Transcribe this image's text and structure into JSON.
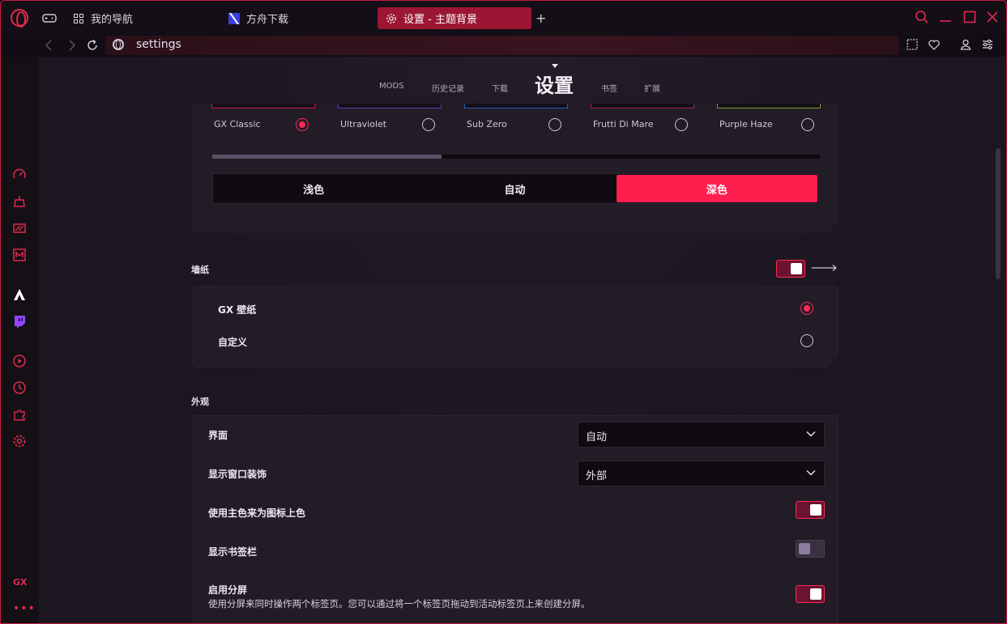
{
  "window": {
    "tabs": [
      {
        "label": "我的导航"
      },
      {
        "label": "方舟下载"
      },
      {
        "label": "设置 - 主题背景"
      }
    ],
    "new_tab": "+"
  },
  "address": {
    "url": "settings"
  },
  "settings_nav": {
    "items": [
      "MODS",
      "历史记录",
      "下载",
      "设置",
      "书签",
      "扩展"
    ]
  },
  "themes": {
    "items": [
      {
        "name": "GX Classic",
        "selected": true,
        "color": "#c41b42"
      },
      {
        "name": "Ultraviolet",
        "selected": false,
        "color": "#5a3aa8"
      },
      {
        "name": "Sub Zero",
        "selected": false,
        "color": "#2a5cb8"
      },
      {
        "name": "Frutti Di Mare",
        "selected": false,
        "color": "#a02050"
      },
      {
        "name": "Purple Haze",
        "selected": false,
        "color": "#7a9a30"
      }
    ],
    "slider_fraction": 0.377,
    "modes": [
      "浅色",
      "自动",
      "深色"
    ],
    "active_mode": "深色"
  },
  "wallpaper": {
    "label": "墙纸",
    "enabled": true,
    "options": [
      {
        "label": "GX 壁纸",
        "selected": true
      },
      {
        "label": "自定义",
        "selected": false
      }
    ]
  },
  "appearance": {
    "label": "外观",
    "rows": [
      {
        "label": "界面",
        "value": "自动"
      },
      {
        "label": "显示窗口装饰",
        "value": "外部"
      },
      {
        "label": "使用主色来为图标上色",
        "toggle": true
      },
      {
        "label": "显示书签栏",
        "toggle": false
      },
      {
        "label": "启用分屏",
        "toggle": true,
        "description": "使用分屏来同时操作两个标签页。您可以通过将一个标签页拖动到活动标签页上来创建分屏。"
      }
    ]
  },
  "sidebar": {
    "gx_label": "GX",
    "more": "•••"
  },
  "colors": {
    "accent": "#ff1f4e",
    "border": "#c41b42",
    "panel": "#221c27"
  }
}
